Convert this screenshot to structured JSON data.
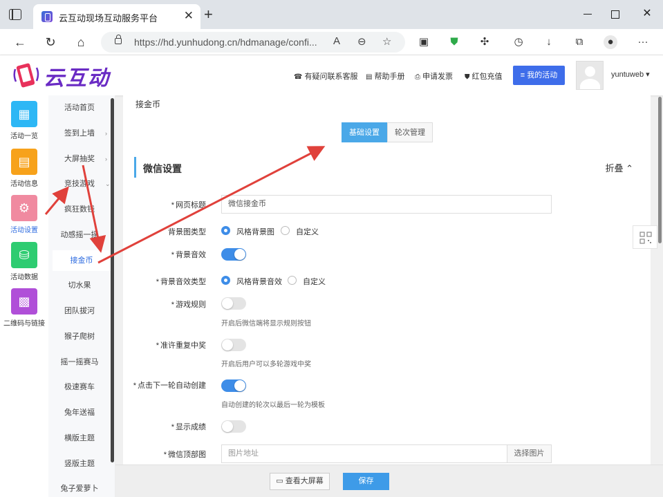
{
  "browser": {
    "tab_title": "云互动现场互动服务平台",
    "url": "https://hd.yunhudong.cn/hdmanage/confi..."
  },
  "header": {
    "logo_text": "云互动",
    "links": [
      {
        "label": "有疑问联系客服",
        "icon": "headset-icon"
      },
      {
        "label": "帮助手册",
        "icon": "book-icon"
      },
      {
        "label": "申请发票",
        "icon": "printer-icon"
      },
      {
        "label": "红包充值",
        "icon": "shield-check-icon"
      }
    ],
    "my_activity": "我的活动",
    "username": "yuntuweb"
  },
  "sidebar": {
    "items": [
      {
        "label": "活动一览",
        "icon": "grid-icon",
        "color": "#2db7f5"
      },
      {
        "label": "活动信息",
        "icon": "document-icon",
        "color": "#f7a21b"
      },
      {
        "label": "活动设置",
        "icon": "gear-icon",
        "color": "#f08aa0"
      },
      {
        "label": "活动数据",
        "icon": "database-icon",
        "color": "#2ecc71"
      },
      {
        "label": "二维码与链接",
        "icon": "qrcode-icon",
        "color": "#b04fd8"
      }
    ]
  },
  "submenu": {
    "items": [
      {
        "label": "活动首页",
        "arrow": ""
      },
      {
        "label": "签到上墙",
        "arrow": "›"
      },
      {
        "label": "大屏抽奖",
        "arrow": "›"
      },
      {
        "label": "竞技游戏",
        "arrow": "⌄"
      },
      {
        "label": "疯狂数钱",
        "arrow": ""
      },
      {
        "label": "动感摇一摇",
        "arrow": ""
      },
      {
        "label": "接金币",
        "arrow": ""
      },
      {
        "label": "切水果",
        "arrow": ""
      },
      {
        "label": "团队拔河",
        "arrow": ""
      },
      {
        "label": "猴子爬树",
        "arrow": ""
      },
      {
        "label": "摇一摇赛马",
        "arrow": ""
      },
      {
        "label": "极速赛车",
        "arrow": ""
      },
      {
        "label": "兔年送福",
        "arrow": ""
      },
      {
        "label": "横版主题",
        "arrow": ""
      },
      {
        "label": "竖版主题",
        "arrow": ""
      },
      {
        "label": "兔子爱萝卜",
        "arrow": ""
      }
    ]
  },
  "main": {
    "page_title": "接金币",
    "tabs": [
      "基础设置",
      "轮次管理"
    ],
    "section_title": "微信设置",
    "fold_label": "折叠 ⌃",
    "fields": {
      "page_title_label": "网页标题",
      "page_title_value": "微信接金币",
      "bg_type_label": "背景图类型",
      "bg_type_options": [
        "风格背景图",
        "自定义"
      ],
      "bg_sound_label": "背景音效",
      "bg_sound_type_label": "背景音效类型",
      "bg_sound_type_options": [
        "风格背景音效",
        "自定义"
      ],
      "rules_label": "游戏规则",
      "rules_hint": "开启后微信端将显示规则按钮",
      "repeat_label": "准许重复中奖",
      "repeat_hint": "开启后用户可以多轮游戏中奖",
      "auto_label": "点击下一轮自动创建",
      "auto_hint": "自动创建的轮次以最后一轮为模板",
      "score_label": "显示成绩",
      "banner_label": "微信顶部图",
      "banner_placeholder": "图片地址",
      "banner_pick": "选择图片"
    }
  },
  "bottom": {
    "view_screen": "查看大屏幕",
    "save": "保存"
  }
}
